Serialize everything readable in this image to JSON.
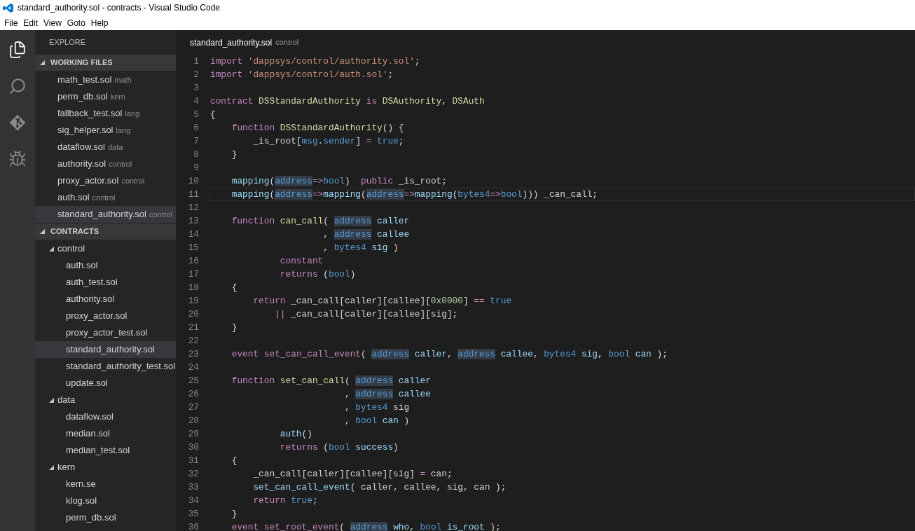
{
  "window": {
    "title": "standard_authority.sol - contracts - Visual Studio Code"
  },
  "menu": [
    "File",
    "Edit",
    "View",
    "Goto",
    "Help"
  ],
  "activity_bar": [
    {
      "kind": "files",
      "selected": true
    },
    {
      "kind": "search",
      "selected": false
    },
    {
      "kind": "git",
      "selected": false
    },
    {
      "kind": "debug",
      "selected": false
    }
  ],
  "sidebar": {
    "title": "EXPLORE",
    "working_files": {
      "title": "WORKING FILES",
      "expanded": true,
      "items": [
        {
          "name": "math_test.sol",
          "folder": "math",
          "selected": false
        },
        {
          "name": "perm_db.sol",
          "folder": "kern",
          "selected": false
        },
        {
          "name": "fallback_test.sol",
          "folder": "lang",
          "selected": false
        },
        {
          "name": "sig_helper.sol",
          "folder": "lang",
          "selected": false
        },
        {
          "name": "dataflow.sol",
          "folder": "data",
          "selected": false
        },
        {
          "name": "authority.sol",
          "folder": "control",
          "selected": false
        },
        {
          "name": "proxy_actor.sol",
          "folder": "control",
          "selected": false
        },
        {
          "name": "auth.sol",
          "folder": "control",
          "selected": false
        },
        {
          "name": "standard_authority.sol",
          "folder": "control",
          "selected": true
        }
      ]
    },
    "contracts": {
      "title": "CONTRACTS",
      "expanded": true,
      "children": [
        {
          "name": "control",
          "expanded": true,
          "selected": false,
          "children": [
            {
              "name": "auth.sol",
              "selected": false
            },
            {
              "name": "auth_test.sol",
              "selected": false
            },
            {
              "name": "authority.sol",
              "selected": false
            },
            {
              "name": "proxy_actor.sol",
              "selected": false
            },
            {
              "name": "proxy_actor_test.sol",
              "selected": false
            },
            {
              "name": "standard_authority.sol",
              "selected": true
            },
            {
              "name": "standard_authority_test.sol",
              "selected": false
            },
            {
              "name": "update.sol",
              "selected": false
            }
          ]
        },
        {
          "name": "data",
          "expanded": true,
          "selected": false,
          "children": [
            {
              "name": "dataflow.sol",
              "selected": false
            },
            {
              "name": "median.sol",
              "selected": false
            },
            {
              "name": "median_test.sol",
              "selected": false
            }
          ]
        },
        {
          "name": "kern",
          "expanded": true,
          "selected": false,
          "children": [
            {
              "name": "kern.se",
              "selected": false
            },
            {
              "name": "klog.sol",
              "selected": false
            },
            {
              "name": "perm_db.sol",
              "selected": false
            }
          ]
        }
      ]
    }
  },
  "editor": {
    "file": "standard_authority.sol",
    "folder": "control",
    "lines": [
      {
        "n": "1",
        "current": false,
        "tokens": [
          {
            "text": "import",
            "kind": "kw"
          },
          {
            "text": " 'dappsys/control/authority.sol'",
            "kind": "str"
          },
          {
            "text": ";",
            "kind": "plain"
          }
        ]
      },
      {
        "n": "2",
        "current": false,
        "tokens": [
          {
            "text": "import",
            "kind": "kw"
          },
          {
            "text": " 'dappsys/control/auth.sol'",
            "kind": "str"
          },
          {
            "text": ";",
            "kind": "plain"
          }
        ]
      },
      {
        "n": "3",
        "current": false
      },
      {
        "n": "4",
        "current": false,
        "tokens": [
          {
            "text": "contract",
            "kind": "kw"
          },
          {
            "text": " DSStandardAuthority",
            "kind": "name"
          },
          {
            "text": " is",
            "kind": "kw"
          },
          {
            "text": " DSAuthority, DSAuth",
            "kind": "name"
          }
        ]
      },
      {
        "n": "5",
        "current": false,
        "tokens": [
          {
            "text": "{",
            "kind": "plain"
          }
        ]
      },
      {
        "n": "6",
        "current": false,
        "tokens": [
          {
            "text": "    function",
            "kind": "kw"
          },
          {
            "text": " DSStandardAuthority",
            "kind": "name"
          },
          {
            "text": "() {",
            "kind": "plain"
          }
        ]
      },
      {
        "n": "7",
        "current": false,
        "tokens": [
          {
            "text": "        _is_root[",
            "kind": "plain"
          },
          {
            "text": "msg",
            "kind": "type"
          },
          {
            "text": ".",
            "kind": "plain"
          },
          {
            "text": "sender",
            "kind": "type"
          },
          {
            "text": "]",
            "kind": "plain"
          },
          {
            "text": " =",
            "kind": "kw"
          },
          {
            "text": " true",
            "kind": "type"
          },
          {
            "text": ";",
            "kind": "plain"
          }
        ]
      },
      {
        "n": "8",
        "current": false,
        "tokens": [
          {
            "text": "    }",
            "kind": "plain"
          }
        ]
      },
      {
        "n": "9",
        "current": false
      },
      {
        "n": "10",
        "current": false,
        "tokens": [
          {
            "text": "    mapping",
            "kind": "var"
          },
          {
            "text": "(",
            "kind": "plain"
          },
          {
            "text": "address",
            "kind": "hl"
          },
          {
            "text": "=>",
            "kind": "kw"
          },
          {
            "text": "bool",
            "kind": "type"
          },
          {
            "text": ")",
            "kind": "plain"
          },
          {
            "text": "  public",
            "kind": "kw"
          },
          {
            "text": " _is_root;",
            "kind": "plain"
          }
        ]
      },
      {
        "n": "11",
        "current": true,
        "tokens": [
          {
            "text": "    mapping",
            "kind": "var"
          },
          {
            "text": "(",
            "kind": "plain"
          },
          {
            "text": "address",
            "kind": "hl"
          },
          {
            "text": "=>",
            "kind": "kw"
          },
          {
            "text": "mapping",
            "kind": "var"
          },
          {
            "text": "(",
            "kind": "plain"
          },
          {
            "text": "address",
            "kind": "hl"
          },
          {
            "text": "=>",
            "kind": "kw"
          },
          {
            "text": "mapping",
            "kind": "var"
          },
          {
            "text": "(",
            "kind": "plain"
          },
          {
            "text": "bytes4",
            "kind": "type"
          },
          {
            "text": "=>",
            "kind": "kw"
          },
          {
            "text": "bool",
            "kind": "type"
          },
          {
            "text": "))) _can_call;",
            "kind": "plain"
          }
        ]
      },
      {
        "n": "12",
        "current": false
      },
      {
        "n": "13",
        "current": false,
        "tokens": [
          {
            "text": "    function",
            "kind": "kw"
          },
          {
            "text": " can_call",
            "kind": "name"
          },
          {
            "text": "( ",
            "kind": "plain"
          },
          {
            "text": "address",
            "kind": "hl"
          },
          {
            "text": " caller",
            "kind": "var"
          }
        ]
      },
      {
        "n": "14",
        "current": false,
        "tokens": [
          {
            "text": "                     , ",
            "kind": "plain"
          },
          {
            "text": "address",
            "kind": "hl"
          },
          {
            "text": " callee",
            "kind": "var"
          }
        ]
      },
      {
        "n": "15",
        "current": false,
        "tokens": [
          {
            "text": "                     , ",
            "kind": "plain"
          },
          {
            "text": "bytes4",
            "kind": "type"
          },
          {
            "text": " sig",
            "kind": "var"
          },
          {
            "text": " )",
            "kind": "plain"
          }
        ]
      },
      {
        "n": "16",
        "current": false,
        "tokens": [
          {
            "text": "             constant",
            "kind": "kw"
          }
        ]
      },
      {
        "n": "17",
        "current": false,
        "tokens": [
          {
            "text": "             returns",
            "kind": "kw"
          },
          {
            "text": " (",
            "kind": "plain"
          },
          {
            "text": "bool",
            "kind": "type"
          },
          {
            "text": ")",
            "kind": "plain"
          }
        ]
      },
      {
        "n": "18",
        "current": false,
        "tokens": [
          {
            "text": "    {",
            "kind": "plain"
          }
        ]
      },
      {
        "n": "19",
        "current": false,
        "tokens": [
          {
            "text": "        return",
            "kind": "kw"
          },
          {
            "text": " _can_call[caller][callee][",
            "kind": "plain"
          },
          {
            "text": "0x0000",
            "kind": "num"
          },
          {
            "text": "]",
            "kind": "plain"
          },
          {
            "text": " ==",
            "kind": "kw"
          },
          {
            "text": " true",
            "kind": "type"
          }
        ]
      },
      {
        "n": "20",
        "current": false,
        "tokens": [
          {
            "text": "            ||",
            "kind": "kw"
          },
          {
            "text": " _can_call[caller][callee][sig];",
            "kind": "plain"
          }
        ]
      },
      {
        "n": "21",
        "current": false,
        "tokens": [
          {
            "text": "    }",
            "kind": "plain"
          }
        ]
      },
      {
        "n": "22",
        "current": false
      },
      {
        "n": "23",
        "current": false,
        "tokens": [
          {
            "text": "    event",
            "kind": "kw"
          },
          {
            "text": " set_can_call_event",
            "kind": "kw"
          },
          {
            "text": "( ",
            "kind": "plain"
          },
          {
            "text": "address",
            "kind": "hl"
          },
          {
            "text": " caller",
            "kind": "var"
          },
          {
            "text": ", ",
            "kind": "plain"
          },
          {
            "text": "address",
            "kind": "hl"
          },
          {
            "text": " callee",
            "kind": "var"
          },
          {
            "text": ", ",
            "kind": "plain"
          },
          {
            "text": "bytes4",
            "kind": "type"
          },
          {
            "text": " sig",
            "kind": "var"
          },
          {
            "text": ", ",
            "kind": "plain"
          },
          {
            "text": "bool",
            "kind": "type"
          },
          {
            "text": " can",
            "kind": "var"
          },
          {
            "text": " );",
            "kind": "plain"
          }
        ]
      },
      {
        "n": "24",
        "current": false
      },
      {
        "n": "25",
        "current": false,
        "tokens": [
          {
            "text": "    function",
            "kind": "kw"
          },
          {
            "text": " set_can_call",
            "kind": "name"
          },
          {
            "text": "( ",
            "kind": "plain"
          },
          {
            "text": "address",
            "kind": "hl"
          },
          {
            "text": " caller",
            "kind": "var"
          }
        ]
      },
      {
        "n": "26",
        "current": false,
        "tokens": [
          {
            "text": "                         , ",
            "kind": "plain"
          },
          {
            "text": "address",
            "kind": "hl"
          },
          {
            "text": " callee",
            "kind": "var"
          }
        ]
      },
      {
        "n": "27",
        "current": false,
        "tokens": [
          {
            "text": "                         , ",
            "kind": "plain"
          },
          {
            "text": "bytes4",
            "kind": "type"
          },
          {
            "text": " sig",
            "kind": "plain"
          }
        ]
      },
      {
        "n": "28",
        "current": false,
        "tokens": [
          {
            "text": "                         , ",
            "kind": "plain"
          },
          {
            "text": "bool",
            "kind": "type"
          },
          {
            "text": " can",
            "kind": "var"
          },
          {
            "text": " )",
            "kind": "plain"
          }
        ]
      },
      {
        "n": "29",
        "current": false,
        "tokens": [
          {
            "text": "             auth",
            "kind": "var"
          },
          {
            "text": "()",
            "kind": "plain"
          }
        ]
      },
      {
        "n": "30",
        "current": false,
        "tokens": [
          {
            "text": "             returns",
            "kind": "kw"
          },
          {
            "text": " (",
            "kind": "plain"
          },
          {
            "text": "bool",
            "kind": "type"
          },
          {
            "text": " success",
            "kind": "var"
          },
          {
            "text": ")",
            "kind": "plain"
          }
        ]
      },
      {
        "n": "31",
        "current": false,
        "tokens": [
          {
            "text": "    {",
            "kind": "plain"
          }
        ]
      },
      {
        "n": "32",
        "current": false,
        "tokens": [
          {
            "text": "        _can_call[caller][callee][sig]",
            "kind": "plain"
          },
          {
            "text": " =",
            "kind": "kw"
          },
          {
            "text": " can;",
            "kind": "plain"
          }
        ]
      },
      {
        "n": "33",
        "current": false,
        "tokens": [
          {
            "text": "        set_can_call_event",
            "kind": "var"
          },
          {
            "text": "( caller, callee, sig, can );",
            "kind": "plain"
          }
        ]
      },
      {
        "n": "34",
        "current": false,
        "tokens": [
          {
            "text": "        return",
            "kind": "kw"
          },
          {
            "text": " true",
            "kind": "type"
          },
          {
            "text": ";",
            "kind": "plain"
          }
        ]
      },
      {
        "n": "35",
        "current": false,
        "tokens": [
          {
            "text": "    }",
            "kind": "plain"
          }
        ]
      },
      {
        "n": "36",
        "current": false,
        "tokens": [
          {
            "text": "    event",
            "kind": "kw"
          },
          {
            "text": " set_root_event",
            "kind": "kw"
          },
          {
            "text": "( ",
            "kind": "plain"
          },
          {
            "text": "address",
            "kind": "hl"
          },
          {
            "text": " who",
            "kind": "var"
          },
          {
            "text": ", ",
            "kind": "plain"
          },
          {
            "text": "bool",
            "kind": "type"
          },
          {
            "text": " is_root",
            "kind": "var"
          },
          {
            "text": " );",
            "kind": "plain"
          }
        ]
      }
    ]
  }
}
